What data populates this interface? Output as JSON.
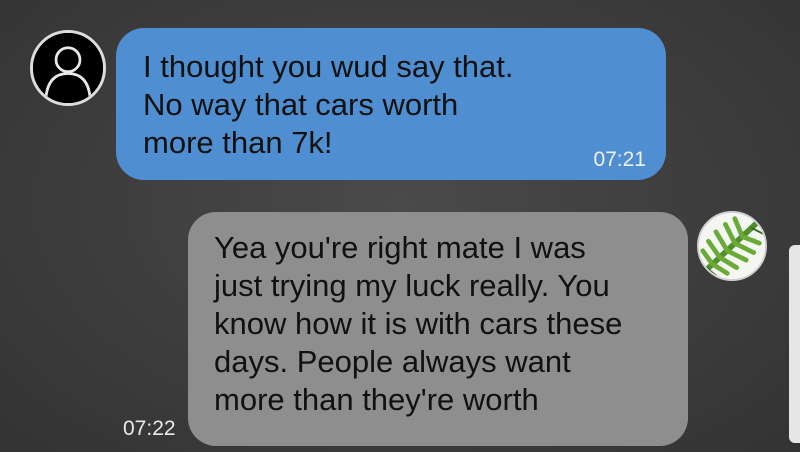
{
  "conversation": {
    "messages": [
      {
        "direction": "outgoing",
        "text": "I thought you wud say that.\nNo way that cars worth\nmore than 7k!",
        "time": "07:21",
        "avatar_icon": "user-silhouette-icon"
      },
      {
        "direction": "incoming",
        "text": "Yea you're right mate I was\njust trying my luck really. You\nknow how it is with cars these\ndays. People always want\nmore than they're worth",
        "time": "07:22",
        "avatar_icon": "fern-leaf-icon"
      }
    ]
  },
  "colors": {
    "outgoing_bubble": "#4f8ed0",
    "incoming_bubble": "#8e8e8e",
    "background": "#3d3d3d",
    "text": "#111111",
    "timestamp": "#f0f0f0"
  }
}
